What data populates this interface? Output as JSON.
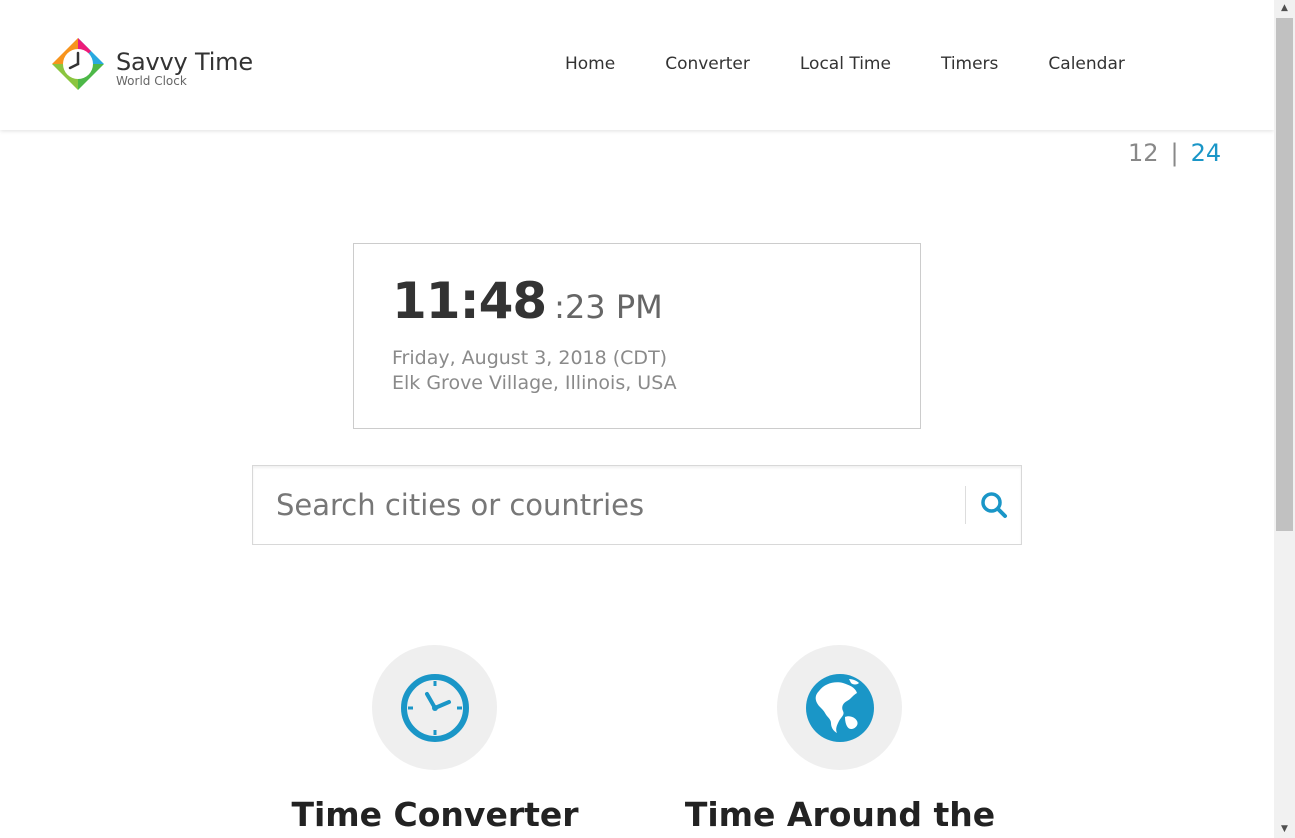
{
  "brand": {
    "name": "Savvy Time",
    "tagline": "World Clock"
  },
  "nav": {
    "items": [
      {
        "label": "Home"
      },
      {
        "label": "Converter"
      },
      {
        "label": "Local Time"
      },
      {
        "label": "Timers"
      },
      {
        "label": "Calendar"
      }
    ]
  },
  "format_toggle": {
    "option_12": "12",
    "separator": "|",
    "option_24": "24",
    "active": "24"
  },
  "clock": {
    "time_main": "11:48",
    "time_seconds": ":23 PM",
    "date": "Friday, August 3, 2018 (CDT)",
    "location": "Elk Grove Village, Illinois, USA"
  },
  "search": {
    "placeholder": "Search cities or countries",
    "value": ""
  },
  "features": [
    {
      "title": "Time Converter",
      "icon": "clock-icon"
    },
    {
      "title": "Time Around the",
      "icon": "globe-icon"
    }
  ],
  "colors": {
    "accent": "#1a96c7",
    "icon_circle_bg": "#efefef"
  }
}
